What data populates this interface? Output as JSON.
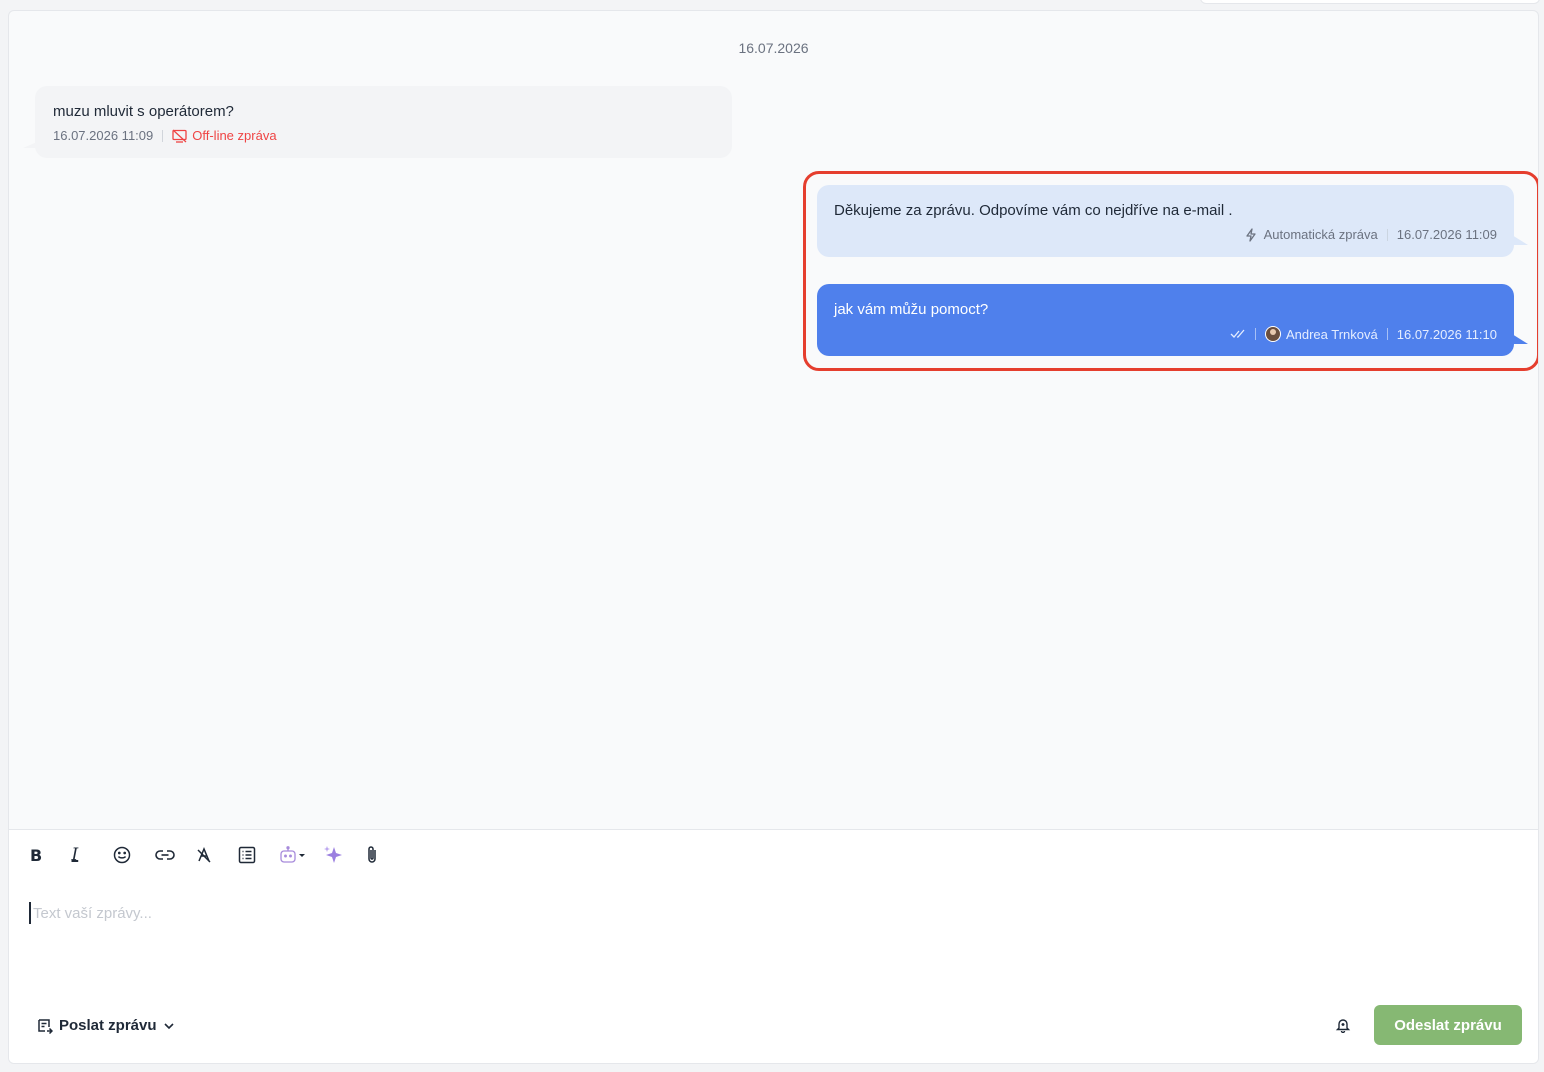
{
  "chat": {
    "date_separator": "16.07.2026",
    "messages": [
      {
        "direction": "incoming",
        "text": "muzu mluvit s operátorem?",
        "time": "16.07.2026 11:09",
        "badge": "Off-line zpráva"
      },
      {
        "direction": "outgoing-auto",
        "text": "Děkujeme za zprávu. Odpovíme vám co nejdříve na e-mail .",
        "label": "Automatická zpráva",
        "time": "16.07.2026 11:09"
      },
      {
        "direction": "outgoing-operator",
        "text": "jak vám můžu pomoct?",
        "operator": "Andrea Trnková",
        "time": "16.07.2026 11:10"
      }
    ]
  },
  "toolbar": {
    "icons": [
      "bold-icon",
      "italic-icon",
      "emoji-icon",
      "link-icon",
      "clear-format-icon",
      "template-list-icon",
      "chatbot-icon",
      "ai-sparkle-icon",
      "attachment-icon"
    ],
    "bold_glyph": "B",
    "italic_glyph": "I"
  },
  "composer": {
    "placeholder": "Text vaší zprávy...",
    "send_mode_label": "Poslat zprávu",
    "send_button_label": "Odeslat zprávu"
  },
  "colors": {
    "incoming_bubble": "#f3f4f6",
    "auto_bubble": "#dde8f9",
    "operator_bubble": "#4f80ec",
    "offline_badge": "#ef4444",
    "send_button": "#86b873",
    "highlight_border": "#e53e2e"
  }
}
